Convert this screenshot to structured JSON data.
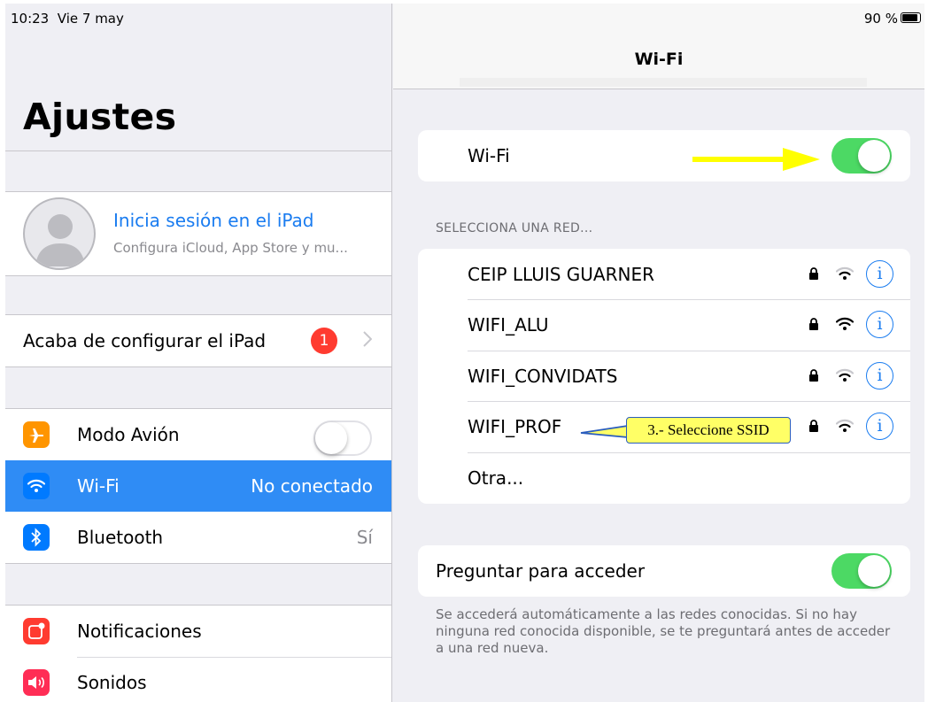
{
  "status": {
    "time": "10:23",
    "date": "Vie 7 may",
    "battery": "90 %"
  },
  "left": {
    "title": "Ajustes",
    "profile": {
      "name": "Inicia sesión en el iPad",
      "subtitle": "Configura iCloud, App Store y mu..."
    },
    "setup": {
      "label": "Acaba de configurar el iPad",
      "badge": "1"
    },
    "connectivity": [
      {
        "label": "Modo Avión",
        "value": "",
        "icon": "airplane-icon",
        "icon_color": "#ff9500"
      },
      {
        "label": "Wi-Fi",
        "value": "No conectado",
        "icon": "wifi-icon",
        "icon_color": "#007aff"
      },
      {
        "label": "Bluetooth",
        "value": "Sí",
        "icon": "bluetooth-icon",
        "icon_color": "#007aff"
      }
    ],
    "notifications": [
      {
        "label": "Notificaciones",
        "icon": "notifications-icon",
        "icon_color": "#ff3b30"
      },
      {
        "label": "Sonidos",
        "icon": "sounds-icon",
        "icon_color": "#ff2d55"
      }
    ]
  },
  "right": {
    "nav_title": "Wi-Fi",
    "wifi_label": "Wi-Fi",
    "wifi_enabled": true,
    "section_header": "SELECCIONA UNA RED...",
    "networks": [
      {
        "name": "CEIP LLUIS GUARNER"
      },
      {
        "name": "WIFI_ALU"
      },
      {
        "name": "WIFI_CONVIDATS"
      },
      {
        "name": "WIFI_PROF"
      },
      {
        "name": "Otra..."
      }
    ],
    "info_glyph": "i",
    "annotation": "3.- Seleccione SSID",
    "ask_label": "Preguntar para acceder",
    "ask_enabled": true,
    "ask_description": "Se accederá automáticamente a las redes conocidas. Si no hay ninguna red conocida disponible, se te preguntará antes de acceder a una red nueva."
  },
  "colors": {
    "accent": "#1a7cf0",
    "toggle_on": "#4cd964",
    "selected_row": "#2f8cf5",
    "badge": "#ff3b30",
    "arrow": "#ffff00"
  }
}
